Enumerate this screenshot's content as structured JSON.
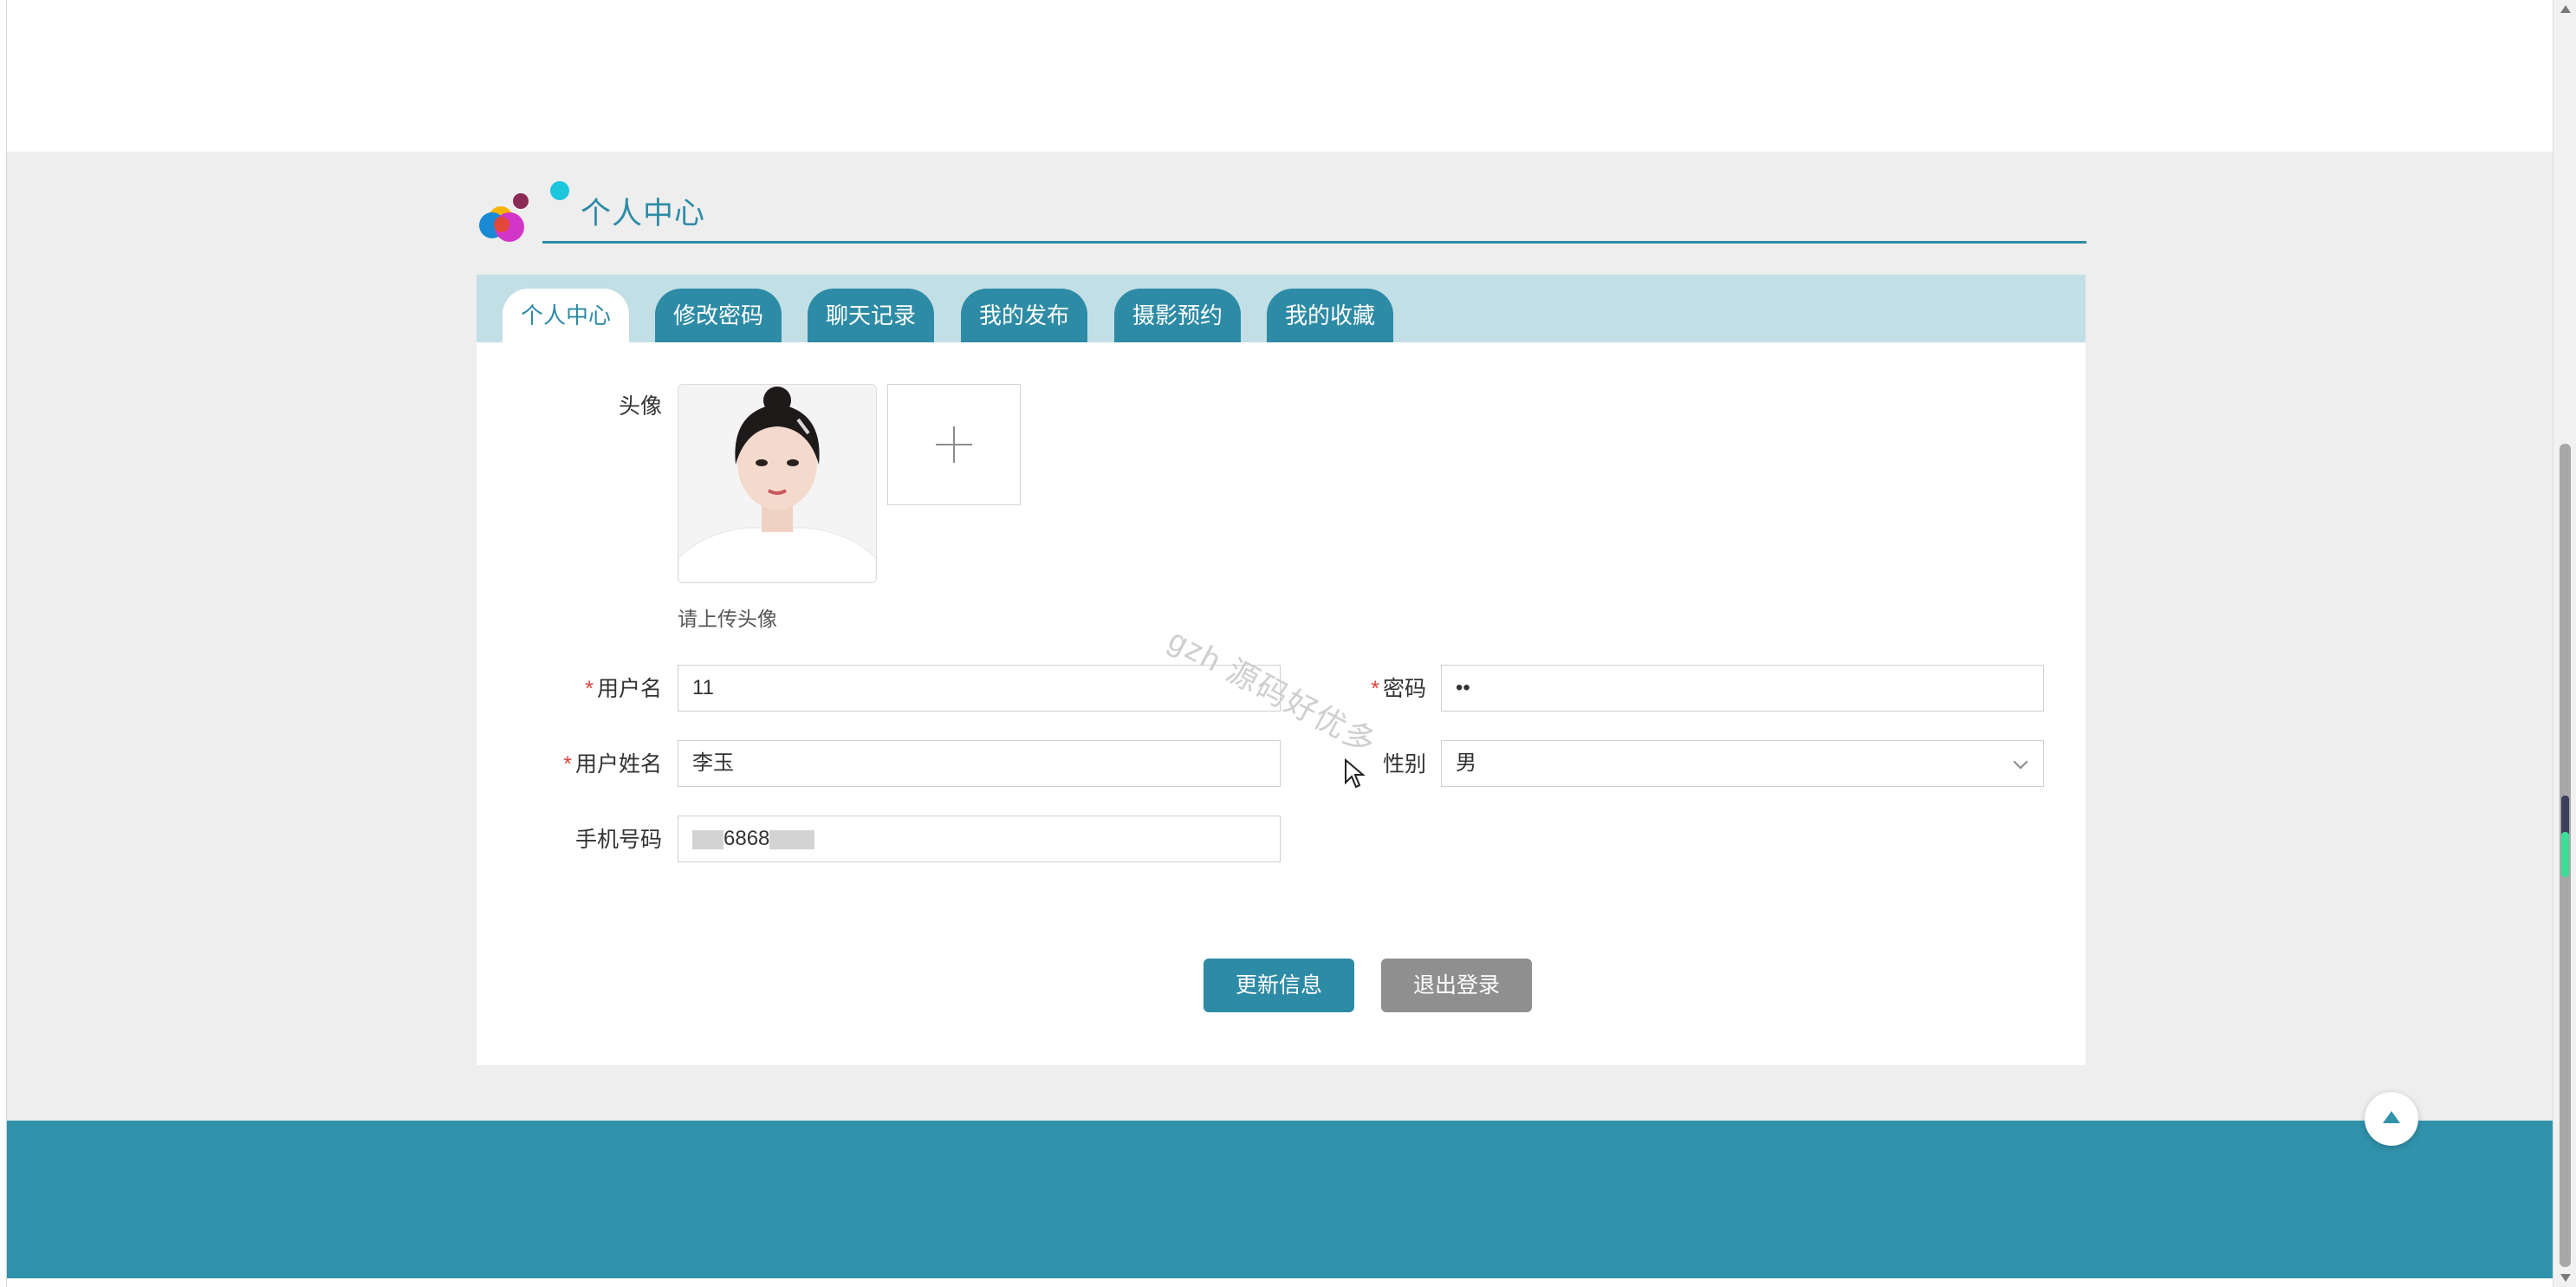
{
  "page": {
    "title": "个人中心",
    "watermark": "gzh 源码好优多"
  },
  "tabs": [
    {
      "label": "个人中心",
      "active": true
    },
    {
      "label": "修改密码",
      "active": false
    },
    {
      "label": "聊天记录",
      "active": false
    },
    {
      "label": "我的发布",
      "active": false
    },
    {
      "label": "摄影预约",
      "active": false
    },
    {
      "label": "我的收藏",
      "active": false
    }
  ],
  "form": {
    "avatar_label": "头像",
    "avatar_hint": "请上传头像",
    "username": {
      "label": "用户名",
      "required": true,
      "value": "11"
    },
    "password": {
      "label": "密码",
      "required": true,
      "value": "••"
    },
    "realname": {
      "label": "用户姓名",
      "required": true,
      "value": "李玉"
    },
    "gender": {
      "label": "性别",
      "value": "男"
    },
    "phone": {
      "label": "手机号码",
      "value_visible": "6868"
    }
  },
  "buttons": {
    "update": "更新信息",
    "logout": "退出登录"
  },
  "colors": {
    "primary": "#2e8ba6",
    "footer": "#3192ac",
    "tabbar_bg": "#c3dfe6",
    "page_bg": "#eeeeee",
    "logout_btn": "#8f8f8f",
    "required": "#e0413b"
  },
  "icons": [
    "logo-bubbles-icon",
    "plus-icon",
    "chevron-down-icon",
    "back-to-top-icon",
    "mouse-cursor-icon"
  ]
}
